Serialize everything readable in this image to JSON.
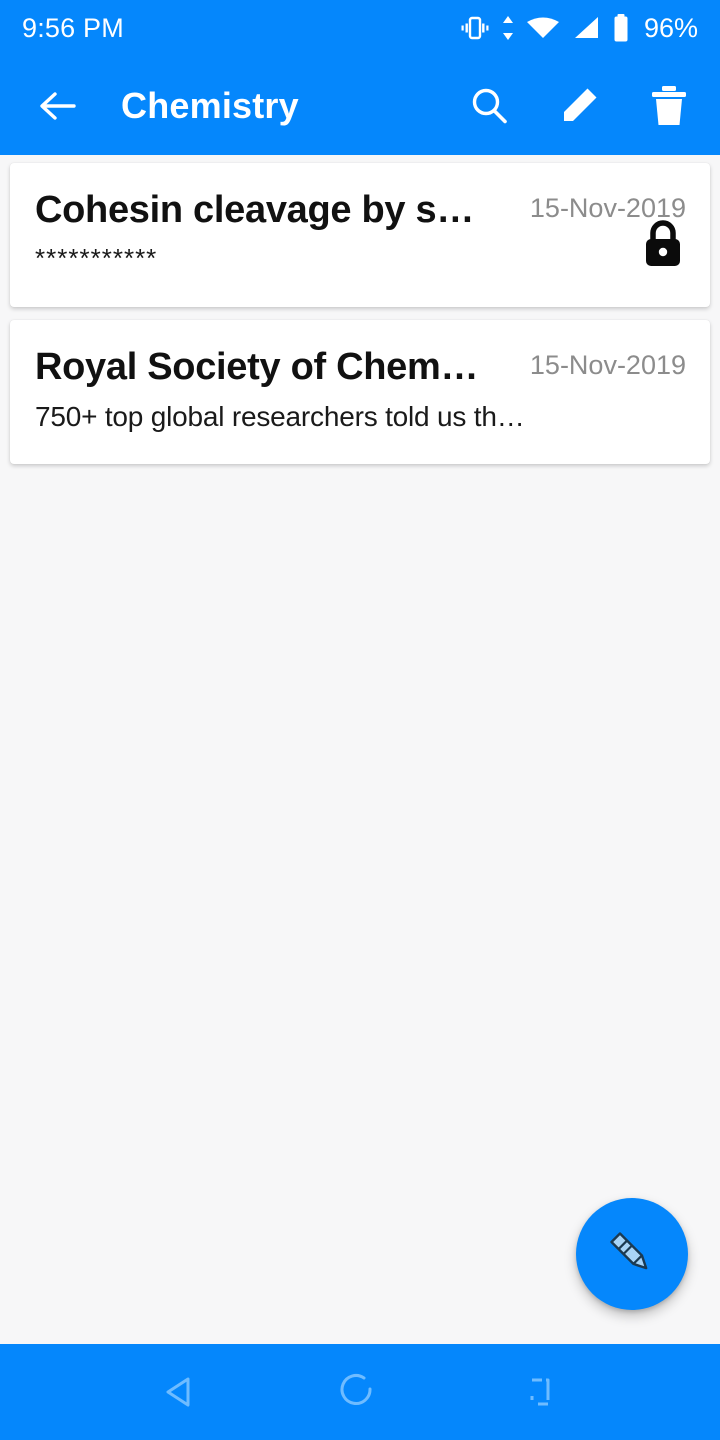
{
  "status_bar": {
    "time": "9:56 PM",
    "battery_percent": "96%",
    "icons": [
      "vibrate-icon",
      "data-transfer-icon",
      "wifi-icon",
      "signal-icon",
      "battery-icon"
    ]
  },
  "app_bar": {
    "title": "Chemistry",
    "back_icon": "arrow-back-icon",
    "actions": [
      {
        "name": "search",
        "icon": "search-icon"
      },
      {
        "name": "edit",
        "icon": "edit-pencil-icon"
      },
      {
        "name": "delete",
        "icon": "trash-icon"
      }
    ]
  },
  "notes": [
    {
      "title": "Cohesin cleavage by s…",
      "date": "15-Nov-2019",
      "snippet": "***********",
      "locked": true,
      "lock_icon": "lock-icon"
    },
    {
      "title": "Royal Society of Chem…",
      "date": "15-Nov-2019",
      "snippet": "750+ top global researchers told us th…",
      "locked": false
    }
  ],
  "fab": {
    "name": "new-note-button",
    "icon": "pencil-icon"
  },
  "nav_bar": {
    "back": "back-triangle-icon",
    "home": "home-circle-icon",
    "recents": "recents-square-icon"
  },
  "colors": {
    "primary": "#0587fc",
    "background": "#f7f7f8",
    "card": "#ffffff",
    "date_text": "#8c8c8c",
    "title_text": "#111111"
  }
}
